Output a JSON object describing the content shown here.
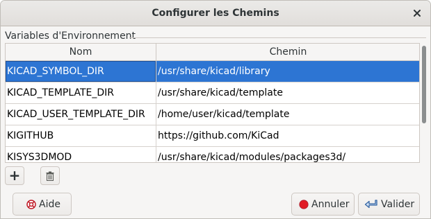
{
  "window": {
    "title": "Configurer les Chemins"
  },
  "group": {
    "label": "Variables d'Environnement"
  },
  "table": {
    "columns": [
      "Nom",
      "Chemin"
    ],
    "rows": [
      {
        "name": "KICAD_SYMBOL_DIR",
        "path": "/usr/share/kicad/library",
        "selected": true
      },
      {
        "name": "KICAD_TEMPLATE_DIR",
        "path": "/usr/share/kicad/template"
      },
      {
        "name": "KICAD_USER_TEMPLATE_DIR",
        "path": "/home/user/kicad/template"
      },
      {
        "name": "KIGITHUB",
        "path": "https://github.com/KiCad"
      },
      {
        "name": "KISYS3DMOD",
        "path": "/usr/share/kicad/modules/packages3d/"
      }
    ]
  },
  "toolbar": {
    "add_label": "+",
    "delete_icon": "trash-icon"
  },
  "buttons": {
    "help": "Aide",
    "cancel": "Annuler",
    "ok": "Valider"
  },
  "colors": {
    "selection": "#2d75d3",
    "cancel_icon": "#e01b24"
  }
}
